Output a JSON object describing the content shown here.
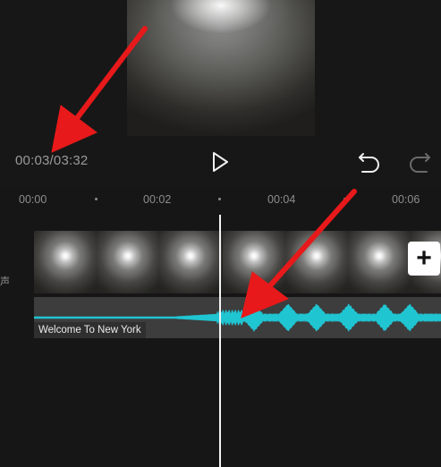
{
  "player": {
    "timecode": "00:03/03:32",
    "icons": {
      "play": "play-icon",
      "undo": "undo-icon",
      "redo": "redo-icon"
    }
  },
  "ruler": {
    "ticks": [
      "00:00",
      "00:02",
      "00:04",
      "00:06"
    ]
  },
  "tracks": {
    "side_label": "声",
    "audio_title": "Welcome To New York",
    "add_clip_label": "+"
  },
  "colors": {
    "background": "#161616",
    "waveform": "#20c5d2",
    "audio_track": "#3d3d3d",
    "annotation_arrow": "#e8191a"
  }
}
